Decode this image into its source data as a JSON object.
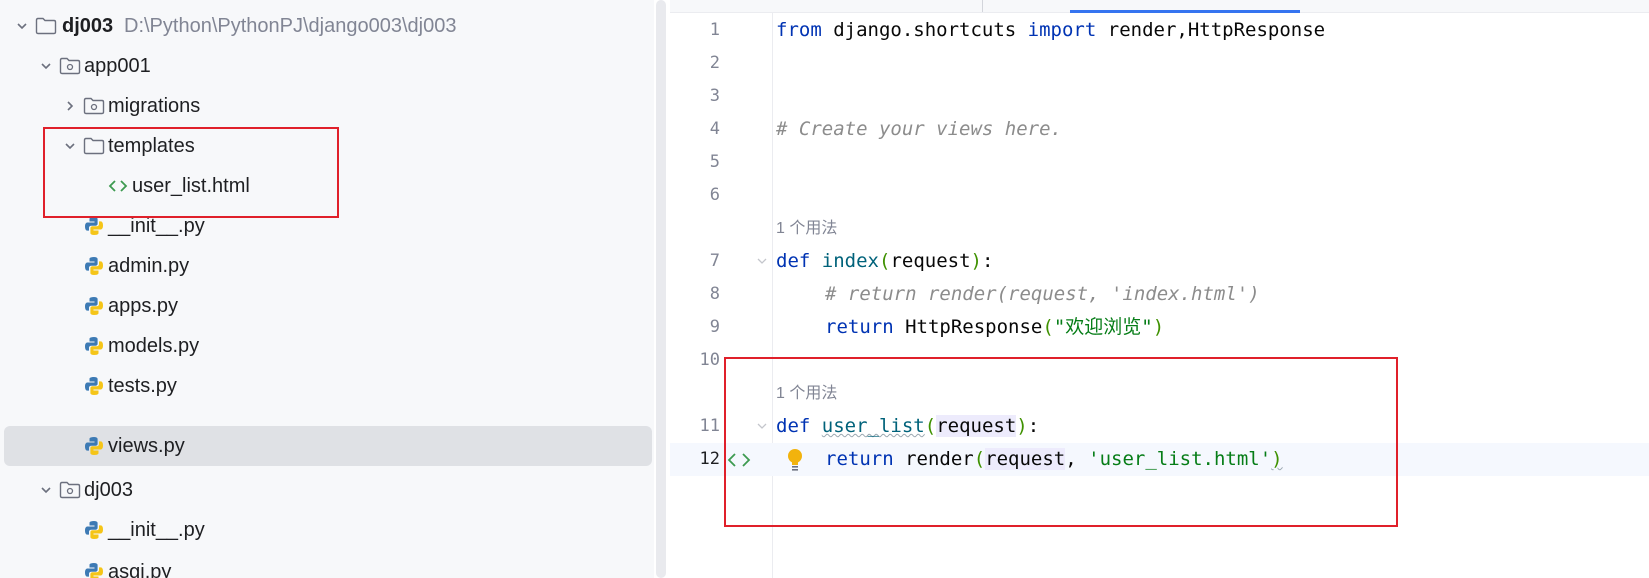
{
  "tree": {
    "root": {
      "name": "dj003",
      "path": "D:\\Python\\PythonPJ\\django003\\dj003"
    },
    "app001": {
      "name": "app001"
    },
    "migrations": {
      "name": "migrations"
    },
    "templates": {
      "name": "templates"
    },
    "user_list": {
      "name": "user_list.html"
    },
    "init1": {
      "name": "__init__.py"
    },
    "admin": {
      "name": "admin.py"
    },
    "apps": {
      "name": "apps.py"
    },
    "models": {
      "name": "models.py"
    },
    "tests": {
      "name": "tests.py"
    },
    "views": {
      "name": "views.py"
    },
    "dj003pkg": {
      "name": "dj003"
    },
    "init2": {
      "name": "__init__.py"
    },
    "asgi": {
      "name": "asgi.py"
    }
  },
  "editor": {
    "line_numbers": [
      "1",
      "2",
      "3",
      "4",
      "5",
      "6",
      "7",
      "8",
      "9",
      "10",
      "11",
      "12"
    ],
    "usage_hint": "1 个用法",
    "l1": {
      "kw1": "from",
      "mod": " django.shortcuts ",
      "kw2": "import",
      "names": " render,HttpResponse"
    },
    "l4": {
      "comment": "# Create your views here."
    },
    "l7": {
      "kw": "def",
      "fn": "index",
      "p1": "(",
      "arg": "request",
      "p2": ")",
      "colon": ":"
    },
    "l8": {
      "comment": "# return render(request, 'index.html')"
    },
    "l9": {
      "kw": "return",
      "call": " HttpResponse",
      "p1": "(",
      "str": "\"欢迎浏览\"",
      "p2": ")"
    },
    "l11": {
      "kw": "def",
      "fn": "user_list",
      "p1": "(",
      "arg": "request",
      "p2": ")",
      "colon": ":"
    },
    "l12": {
      "kw": "return",
      "call": " render",
      "p1": "(",
      "arg": "request",
      "comma": ", ",
      "str": "'user_list.html'",
      "p2": ")"
    }
  },
  "colors": {
    "keyword": "#0033b3",
    "function": "#00627a",
    "string": "#067d17",
    "comment": "#8c8c8c",
    "annotation_red": "#e0202a",
    "python_blue": "#3d7ab4",
    "python_yellow": "#f5c518",
    "html_green": "#3d9a50"
  },
  "icons": [
    "chevron-down-icon",
    "chevron-right-icon",
    "folder-icon",
    "package-folder-icon",
    "html-file-icon",
    "python-file-icon",
    "lightbulb-icon",
    "fold-icon"
  ]
}
